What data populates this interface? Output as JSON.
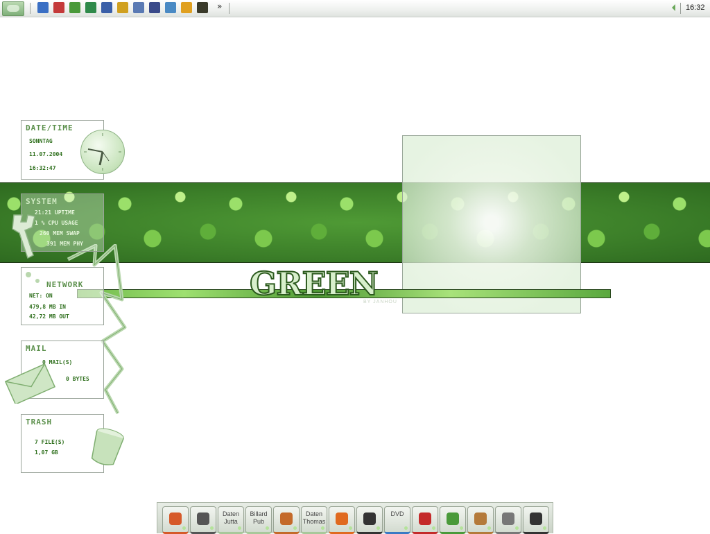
{
  "taskbar": {
    "clock": "16:32",
    "overflow_chevron": "»",
    "quick_launch": [
      {
        "icon": "globe-icon",
        "color": "#3a6fc4"
      },
      {
        "icon": "pc-icon",
        "color": "#c43a3a"
      },
      {
        "icon": "picture-icon",
        "color": "#4a9a3a"
      },
      {
        "icon": "disc-icon",
        "color": "#2f8a4a"
      },
      {
        "icon": "network-icon",
        "color": "#3a5fa8"
      },
      {
        "icon": "transfer-icon",
        "color": "#d0a020"
      },
      {
        "icon": "tools-icon",
        "color": "#5a7ab4"
      },
      {
        "icon": "calendar-icon",
        "color": "#3a4a8a"
      },
      {
        "icon": "earth-icon",
        "color": "#4a8ac4"
      },
      {
        "icon": "media-icon",
        "color": "#e0a020"
      },
      {
        "icon": "notes-icon",
        "color": "#3a3a2a"
      }
    ]
  },
  "desklets": {
    "datetime": {
      "title": "DATE/TIME",
      "day": "SONNTAG",
      "date": "11.07.2004",
      "time": "16:32:47"
    },
    "system": {
      "title": "SYSTEM",
      "uptime": "21:21 UPTIME",
      "cpu": "1   % CPU USAGE",
      "swap": "260 MEM SWAP",
      "phy": "391 MEM PHY"
    },
    "network": {
      "title": "NETWORK",
      "status": "NET:  ON",
      "in": "479,8 MB IN",
      "out": "42,72 MB OUT"
    },
    "mail": {
      "title": "MAIL",
      "mails": "0 MAIL(S)",
      "bytes": "0 BYTES"
    },
    "trash": {
      "title": "TRASH",
      "files": "7 FILE(S)",
      "size": "1,07 GB"
    }
  },
  "wallpaper": {
    "logo": "GREEN",
    "byline": "BY JANHOU"
  },
  "dock": {
    "items": [
      {
        "name": "windows-icon",
        "label": "",
        "color": "#d65a2a"
      },
      {
        "name": "gear-icon",
        "label": "",
        "color": "#555"
      },
      {
        "name": "folder-daten-jutta",
        "label": "Daten Jutta",
        "color": "#a8c89a"
      },
      {
        "name": "folder-billard-pub",
        "label": "Billard Pub",
        "color": "#a8c89a"
      },
      {
        "name": "pliers-icon",
        "label": "",
        "color": "#c46a2a"
      },
      {
        "name": "folder-daten-thomas",
        "label": "Daten Thomas",
        "color": "#a8c89a"
      },
      {
        "name": "comic-icon",
        "label": "",
        "color": "#e06a20"
      },
      {
        "name": "piano-icon",
        "label": "",
        "color": "#333"
      },
      {
        "name": "dvd-icon",
        "label": "DVD",
        "color": "#3a7ac4"
      },
      {
        "name": "download-icon",
        "label": "",
        "color": "#c42a2a"
      },
      {
        "name": "photo-icon",
        "label": "",
        "color": "#4a9a3a"
      },
      {
        "name": "mule-icon",
        "label": "",
        "color": "#b47a3a"
      },
      {
        "name": "document-icon",
        "label": "",
        "color": "#777"
      },
      {
        "name": "printer-icon",
        "label": "",
        "color": "#333"
      }
    ]
  }
}
